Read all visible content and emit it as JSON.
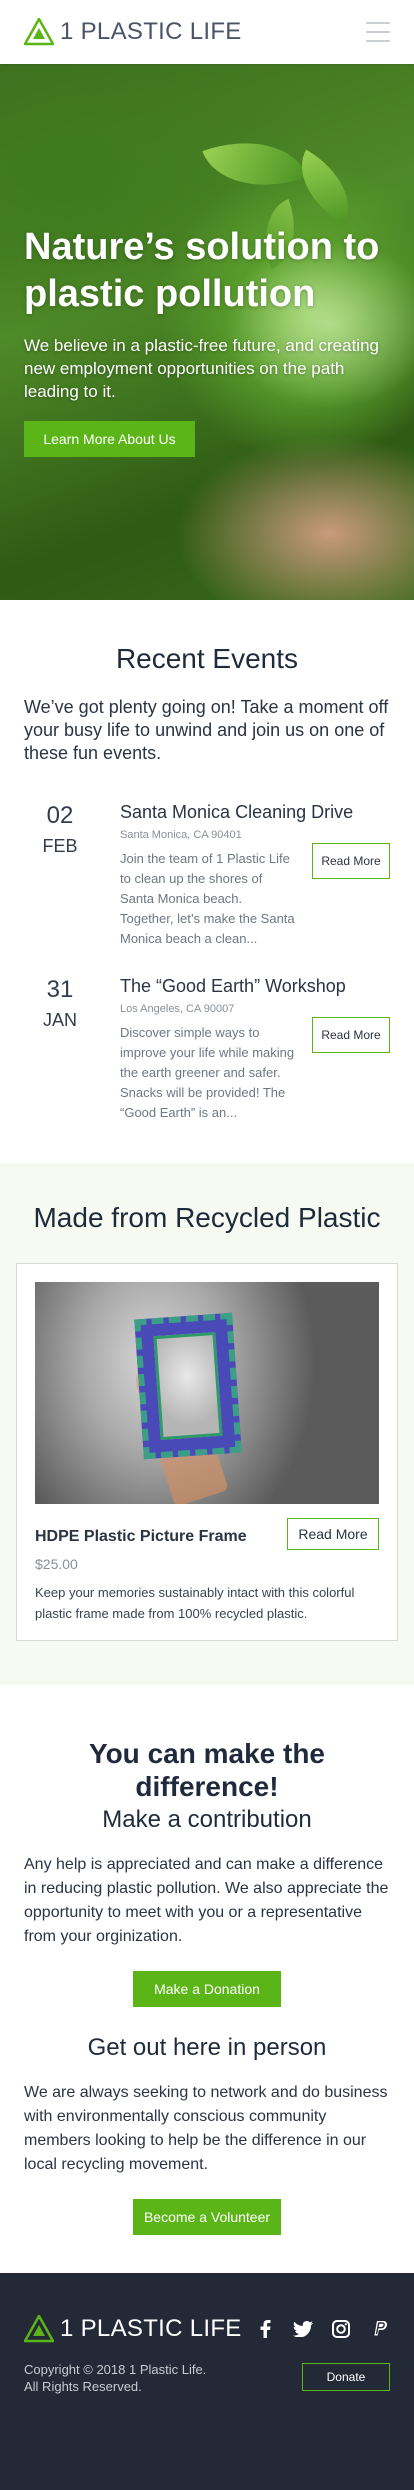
{
  "header": {
    "brand_num": "1",
    "brand_name": "PLASTIC LIFE"
  },
  "hero": {
    "title": "Nature’s solution to plastic pollution",
    "subtitle": "We believe in a plastic-free future, and creating new employment opportunities on the path leading to it.",
    "cta_label": "Learn More About Us"
  },
  "events": {
    "title": "Recent Events",
    "intro": "We’ve got plenty going on! Take a moment off your busy life to unwind and join us on one of these fun events.",
    "items": [
      {
        "day": "02",
        "month": "FEB",
        "title": "Santa Monica Cleaning Drive",
        "location": "Santa Monica, CA 90401",
        "description": "Join the team of 1 Plastic Life to clean up the shores of Santa Monica beach. Together, let’s make the Santa Monica beach a clean...",
        "button": "Read More"
      },
      {
        "day": "31",
        "month": "JAN",
        "title": "The “Good Earth” Workshop",
        "location": "Los Angeles, CA 90007",
        "description": "Discover simple ways to improve your life while making the earth greener and safer. Snacks will be provided! The “Good Earth” is an...",
        "button": "Read More"
      }
    ]
  },
  "products": {
    "title": "Made from Recycled Plastic",
    "item": {
      "name": "HDPE Plastic Picture Frame",
      "price": "$25.00",
      "button": "Read More",
      "description": "Keep your memories sustainably intact with this colorful plastic frame made from 100% recycled plastic."
    }
  },
  "contribute": {
    "title": "You can make the difference!",
    "subtitle": "Make a contribution",
    "text": "Any help is appreciated and can make a difference in reducing plastic pollution. We also appreciate the opportunity to meet with you or a representative from your orginization.",
    "button": "Make a Donation",
    "subtitle2": "Get out here in person",
    "text2": "We are always seeking to network and do business with environmentally conscious community members looking to help be the difference in our local recycling movement.",
    "button2": "Become a Volunteer"
  },
  "footer": {
    "brand_num": "1",
    "brand_name": "PLASTIC LIFE",
    "copyright_line1": "Copyright © 2018 1 Plastic Life.",
    "copyright_line2": "All Rights Reserved.",
    "donate": "Donate",
    "socials": [
      "facebook-icon",
      "twitter-icon",
      "instagram-icon",
      "paypal-icon"
    ]
  },
  "colors": {
    "accent": "#5cb516",
    "footer_bg": "#232936",
    "products_bg": "#f6faf0",
    "text": "#2c3344"
  }
}
